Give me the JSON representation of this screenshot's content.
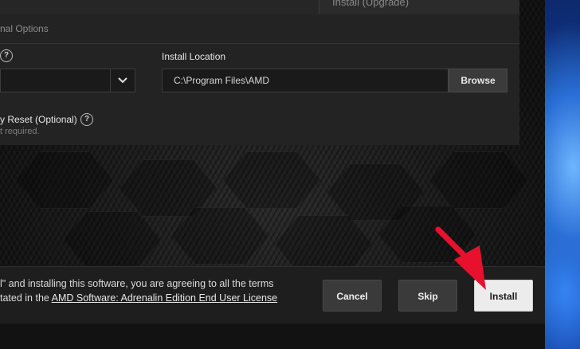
{
  "top_strip": {
    "upgrade_label": "Install (Upgrade)"
  },
  "options": {
    "section_title": "nal Options",
    "location_label": "Install Location",
    "location_value": "C:\\Program Files\\AMD",
    "browse_label": "Browse",
    "reset_label": "y Reset (Optional)",
    "reset_note": "t required."
  },
  "footer": {
    "legal_line1": "l\" and installing this software, you are agreeing to all the terms",
    "legal_line2_prefix": "tated in the ",
    "legal_link": "AMD Software: Adrenalin Edition End User License",
    "cancel_label": "Cancel",
    "skip_label": "Skip",
    "install_label": "Install"
  },
  "icons": {
    "help": "question-circle-icon",
    "dropdown": "chevron-down-icon",
    "annotation": "red-arrow"
  },
  "colors": {
    "annotation_arrow": "#e8112d",
    "install_button": "#ececec"
  }
}
